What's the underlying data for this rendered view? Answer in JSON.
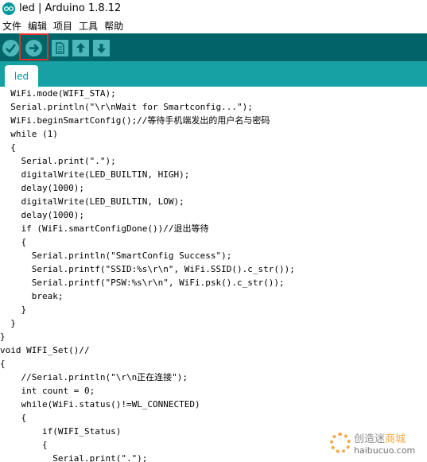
{
  "window": {
    "title": "led | Arduino 1.8.12",
    "icon": "arduino-icon"
  },
  "menu": [
    "文件",
    "编辑",
    "项目",
    "工具",
    "帮助"
  ],
  "toolbar": {
    "buttons": [
      {
        "name": "verify-button",
        "icon": "check-icon"
      },
      {
        "name": "upload-button",
        "icon": "arrow-right-icon"
      },
      {
        "name": "new-button",
        "icon": "file-icon"
      },
      {
        "name": "open-button",
        "icon": "arrow-up-icon"
      },
      {
        "name": "save-button",
        "icon": "arrow-down-icon"
      }
    ],
    "highlight_color": "#e3322b"
  },
  "tab": {
    "label": "led"
  },
  "colors": {
    "toolbar": "#006468",
    "tabbar": "#17a1a5",
    "keyword": "#00979c",
    "object": "#d35400"
  },
  "code": [
    "  WiFi.mode(WIFI_STA);",
    "  Serial.println(\"\\r\\nWait for Smartconfig...\");",
    "  WiFi.beginSmartConfig();//等待手机端发出的用户名与密码",
    "  while (1)",
    "  {",
    "    Serial.print(\".\");",
    "    digitalWrite(LED_BUILTIN, HIGH);",
    "    delay(1000);",
    "    digitalWrite(LED_BUILTIN, LOW);",
    "    delay(1000);",
    "    if (WiFi.smartConfigDone())//退出等待",
    "    {",
    "      Serial.println(\"SmartConfig Success\");",
    "      Serial.printf(\"SSID:%s\\r\\n\", WiFi.SSID().c_str());",
    "      Serial.printf(\"PSW:%s\\r\\n\", WiFi.psk().c_str());",
    "      break;",
    "    }",
    "  }",
    "}",
    "void WIFI_Set()//",
    "{",
    "    //Serial.println(\"\\r\\n正在连接\");",
    "    int count = 0;",
    "    while(WiFi.status()!=WL_CONNECTED)",
    "    {",
    "        if(WIFI_Status)",
    "        {",
    "          Serial.print(\".\");"
  ],
  "watermark": {
    "line1_a": "创造迷",
    "line1_b": "商城",
    "line2": "haibucuo.com"
  }
}
